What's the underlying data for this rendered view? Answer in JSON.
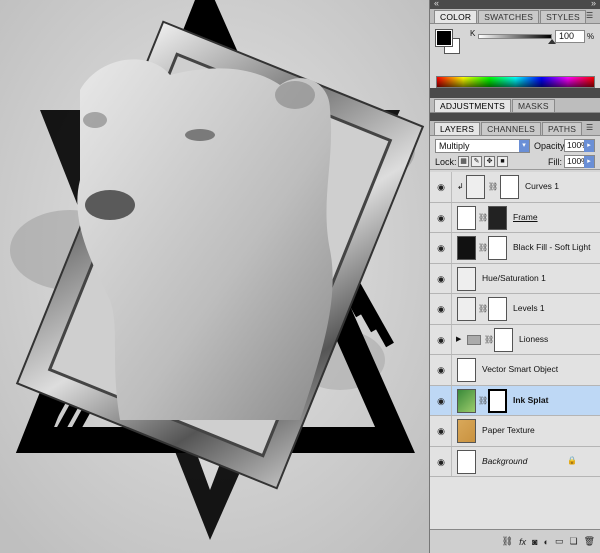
{
  "color_panel": {
    "tabs": [
      "COLOR",
      "SWATCHES",
      "STYLES"
    ],
    "channel_label": "K",
    "channel_value": "100",
    "percent": "%",
    "foreground": "#000000",
    "background": "#ffffff"
  },
  "adjust_panel": {
    "tabs": [
      "ADJUSTMENTS",
      "MASKS"
    ]
  },
  "layers_panel": {
    "tabs": [
      "LAYERS",
      "CHANNELS",
      "PATHS"
    ],
    "blend_mode": "Multiply",
    "opacity_label": "Opacity:",
    "opacity_value": "100%",
    "lock_label": "Lock:",
    "fill_label": "Fill:",
    "fill_value": "100%",
    "layers": [
      {
        "name": "Curves 1"
      },
      {
        "name": "Frame"
      },
      {
        "name": "Black Fill - Soft Light"
      },
      {
        "name": "Hue/Saturation 1"
      },
      {
        "name": "Levels 1"
      },
      {
        "name": "Lioness"
      },
      {
        "name": "Vector Smart Object"
      },
      {
        "name": "Ink Splat"
      },
      {
        "name": "Paper Texture"
      },
      {
        "name": "Background"
      }
    ],
    "footer_icons": [
      "link-icon",
      "fx-icon",
      "mask-icon",
      "adjustment-icon",
      "folder-icon",
      "new-layer-icon",
      "trash-icon"
    ]
  }
}
